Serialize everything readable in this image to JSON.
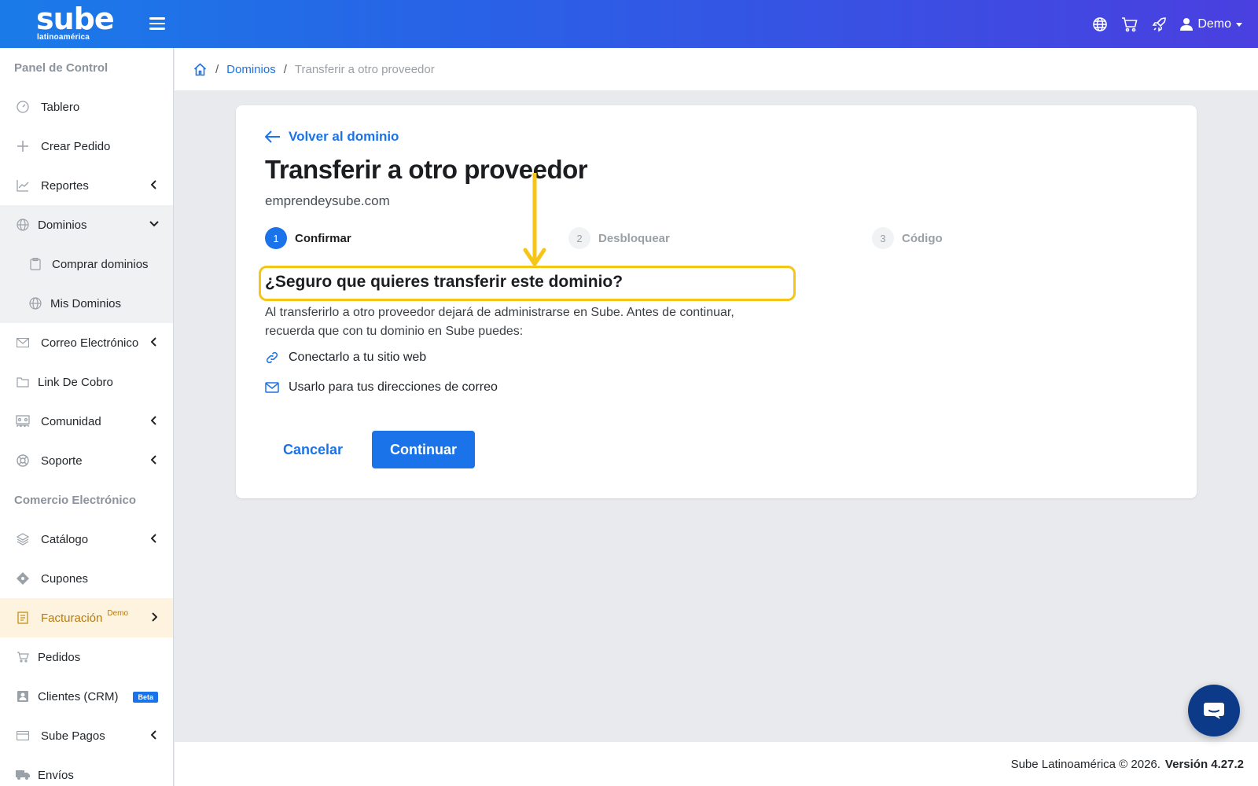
{
  "brand": {
    "logo_main": "sube",
    "logo_sub": "latinoamérica"
  },
  "topbar": {
    "user_label": "Demo"
  },
  "sidebar": {
    "sections": [
      "Panel de Control",
      "Comercio Electrónico"
    ],
    "items": [
      {
        "label": "Tablero"
      },
      {
        "label": "Crear Pedido"
      },
      {
        "label": "Reportes"
      },
      {
        "label": "Dominios"
      },
      {
        "label": "Comprar dominios"
      },
      {
        "label": "Mis Dominios"
      },
      {
        "label": "Correo Electrónico"
      },
      {
        "label": "Link De Cobro"
      },
      {
        "label": "Comunidad"
      },
      {
        "label": "Soporte"
      },
      {
        "label": "Catálogo"
      },
      {
        "label": "Cupones"
      },
      {
        "label": "Facturación",
        "badge": "Demo"
      },
      {
        "label": "Pedidos"
      },
      {
        "label": "Clientes (CRM)",
        "badge": "Beta"
      },
      {
        "label": "Sube Pagos"
      },
      {
        "label": "Envíos"
      }
    ]
  },
  "breadcrumb": {
    "link": "Dominios",
    "sep": "/",
    "current": "Transferir a otro proveedor"
  },
  "card": {
    "back_label": "Volver al dominio",
    "title": "Transferir a otro proveedor",
    "domain": "emprendeysube.com",
    "steps": [
      {
        "num": "1",
        "label": "Confirmar"
      },
      {
        "num": "2",
        "label": "Desbloquear"
      },
      {
        "num": "3",
        "label": "Código"
      }
    ],
    "question": "¿Seguro que quieres transferir este dominio?",
    "paragraph": "Al transferirlo a otro proveedor dejará de administrarse en Sube. Antes de continuar, recuerda que con tu dominio en Sube puedes:",
    "features": [
      "Conectarlo a tu sitio web",
      "Usarlo para tus direcciones de correo"
    ],
    "cancel_label": "Cancelar",
    "continue_label": "Continuar"
  },
  "footer": {
    "copyright": "Sube Latinoamérica © 2026.",
    "version": "Versión 4.27.2"
  },
  "colors": {
    "primary": "#1a73e8",
    "highlight": "#f5c518",
    "active_bg": "#fdf3df"
  }
}
